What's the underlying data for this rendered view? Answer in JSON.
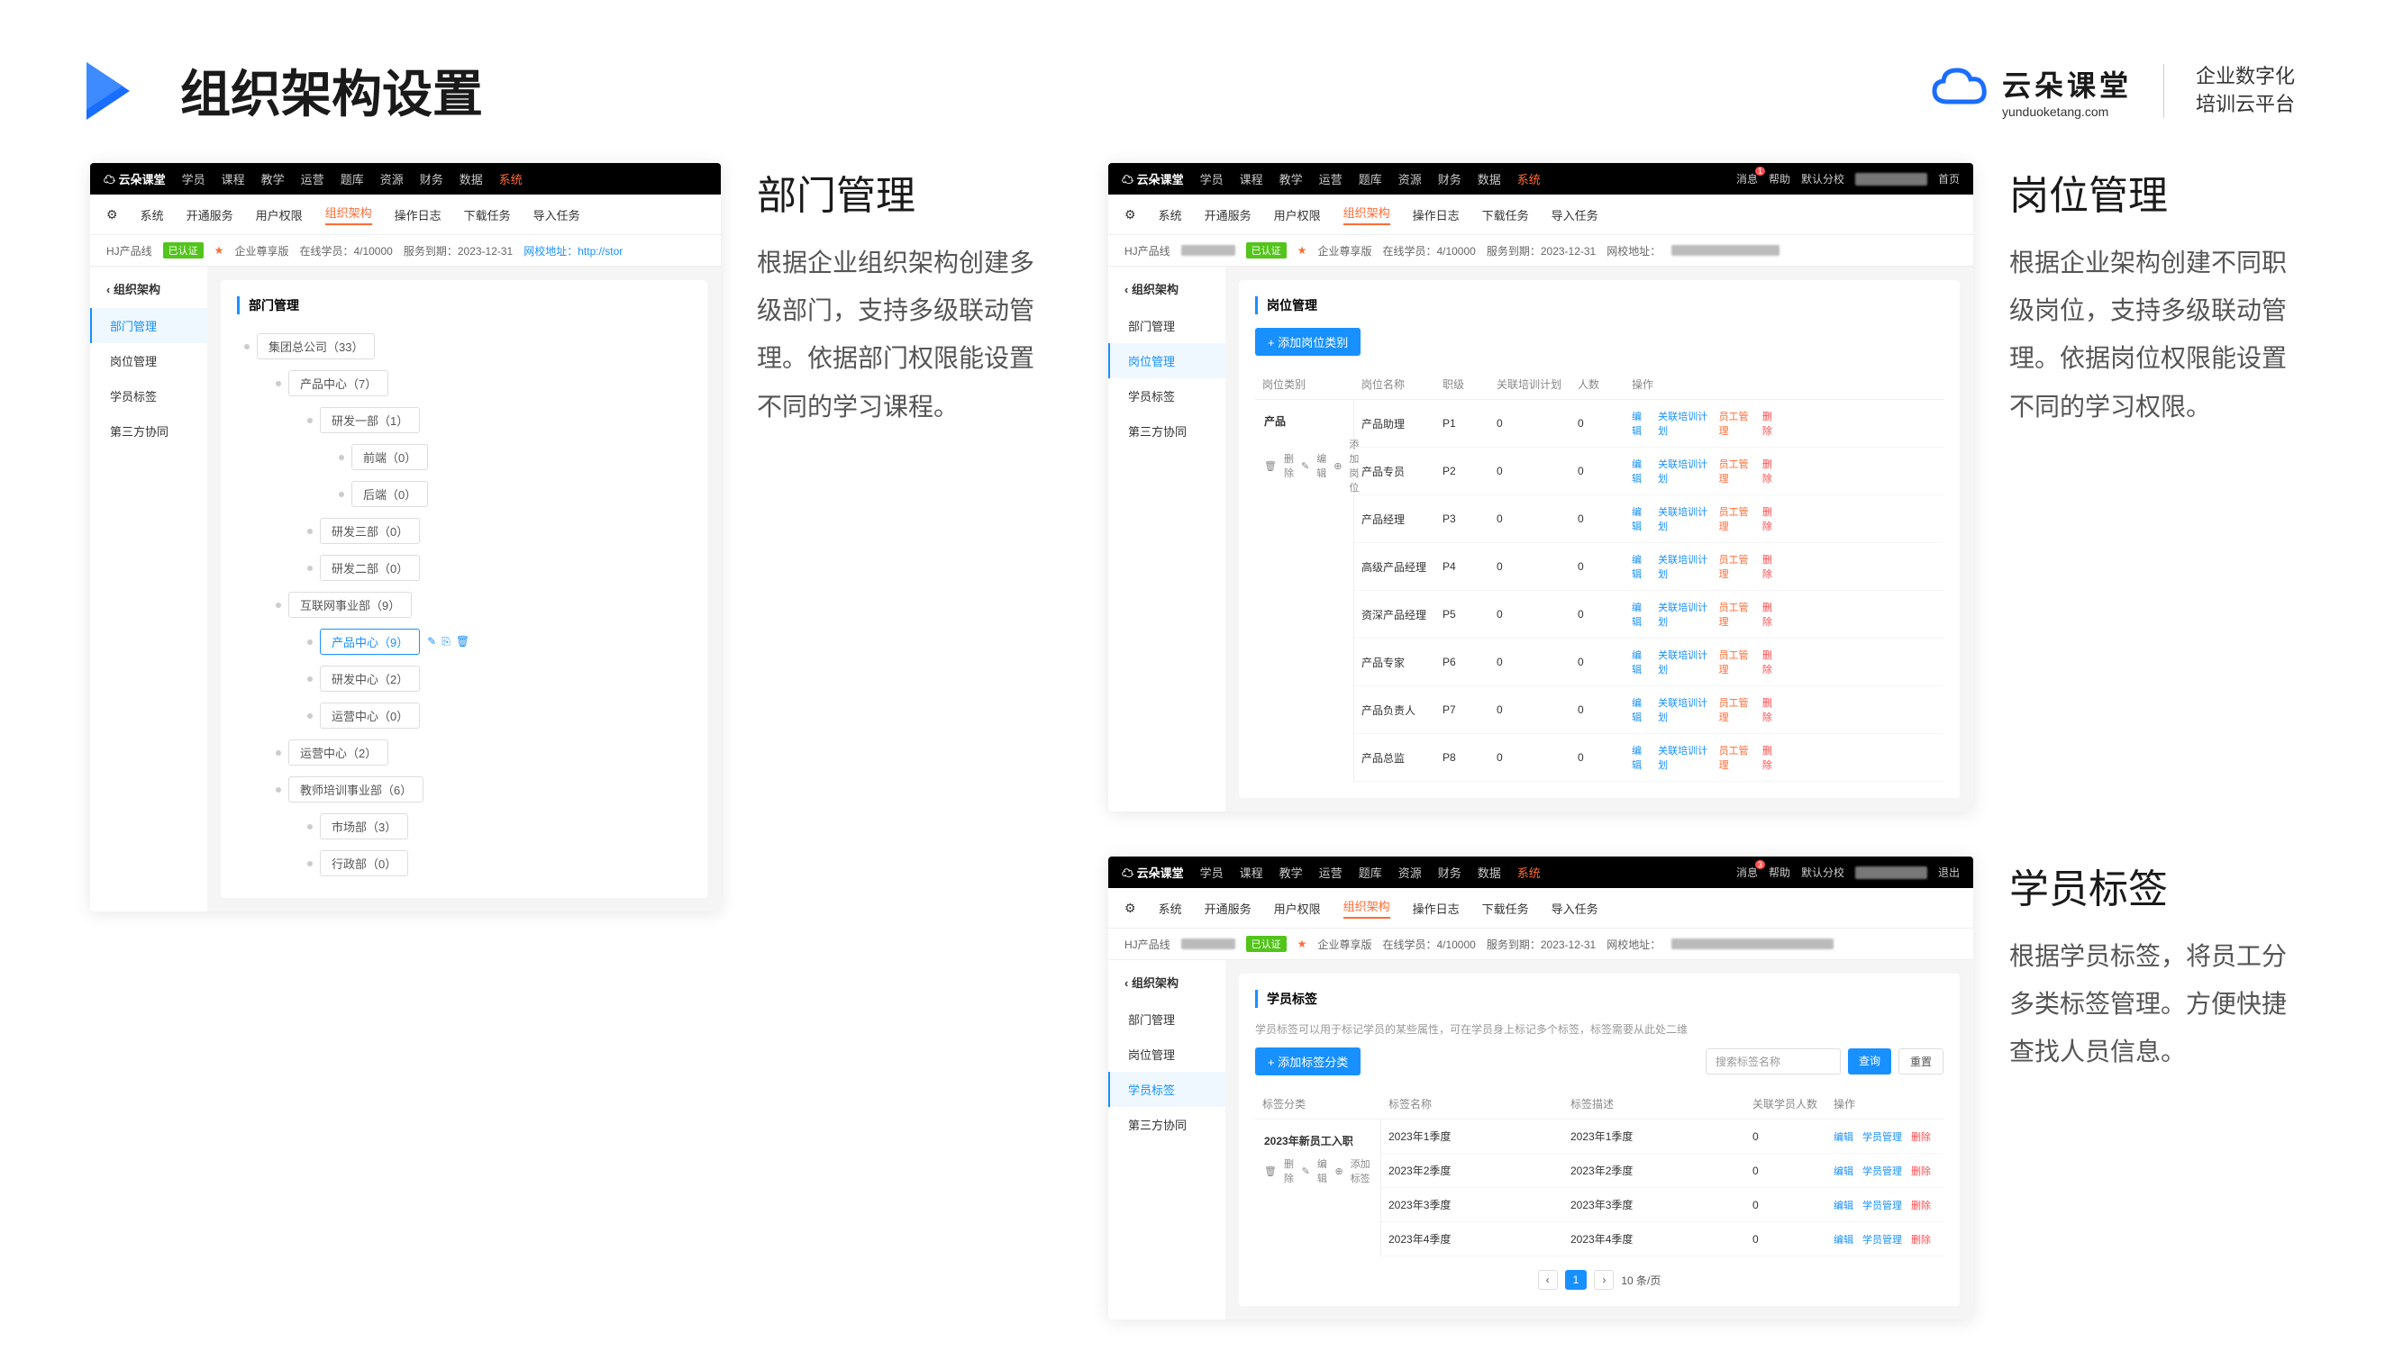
{
  "header": {
    "title": "组织架构设置",
    "brand": "云朵课堂",
    "brand_en": "yunduoketang.com",
    "slogan1": "企业数字化",
    "slogan2": "培训云平台"
  },
  "sections": {
    "dept": {
      "title": "部门管理",
      "desc": "根据企业组织架构创建多级部门，支持多级联动管理。依据部门权限能设置不同的学习课程。"
    },
    "job": {
      "title": "岗位管理",
      "desc": "根据企业架构创建不同职级岗位，支持多级联动管理。依据岗位权限能设置不同的学习权限。"
    },
    "tag": {
      "title": "学员标签",
      "desc": "根据学员标签，将员工分多类标签管理。方便快捷查找人员信息。"
    }
  },
  "topnav": [
    "学员",
    "课程",
    "教学",
    "运营",
    "题库",
    "资源",
    "财务",
    "数据",
    "系统"
  ],
  "subnav": [
    "开通服务",
    "用户权限",
    "组织架构",
    "操作日志",
    "下载任务",
    "导入任务"
  ],
  "sys": "系统",
  "hj": "HJ产品线",
  "meta": {
    "cert": "已认证",
    "plan": "企业尊享版",
    "online": "在线学员：4/10000",
    "expire": "服务到期：2023-12-31",
    "host": "网校地址：http://stor"
  },
  "top_right": {
    "msg": "消息",
    "help": "帮助",
    "branch": "默认分校",
    "home": "首页",
    "exit": "退出"
  },
  "sidebar": {
    "title": "组织架构",
    "items": [
      "部门管理",
      "岗位管理",
      "学员标签",
      "第三方协同"
    ]
  },
  "tree_title": "部门管理",
  "tree": [
    {
      "label": "集团总公司（33）",
      "level": 0
    },
    {
      "label": "产品中心（7）",
      "level": 1
    },
    {
      "label": "研发一部（1）",
      "level": 2
    },
    {
      "label": "前端（0）",
      "level": 3
    },
    {
      "label": "后端（0）",
      "level": 3
    },
    {
      "label": "研发三部（0）",
      "level": 2
    },
    {
      "label": "研发二部（0）",
      "level": 2
    },
    {
      "label": "互联网事业部（9）",
      "level": 1
    },
    {
      "label": "产品中心（9）",
      "level": 2,
      "selected": true
    },
    {
      "label": "研发中心（2）",
      "level": 2
    },
    {
      "label": "运营中心（0）",
      "level": 2
    },
    {
      "label": "运营中心（2）",
      "level": 1
    },
    {
      "label": "教师培训事业部（6）",
      "level": 1
    },
    {
      "label": "市场部（3）",
      "level": 2
    },
    {
      "label": "行政部（0）",
      "level": 2
    }
  ],
  "job": {
    "panel_title": "岗位管理",
    "add_btn": "+  添加岗位类别",
    "headers": [
      "岗位类别",
      "岗位名称",
      "职级",
      "关联培训计划",
      "人数",
      "操作"
    ],
    "cat": "产品",
    "cat_ops": {
      "del": "删除",
      "edit": "编辑",
      "add": "添加岗位"
    },
    "rows": [
      {
        "name": "产品助理",
        "level": "P1",
        "plan": 0,
        "count": 0
      },
      {
        "name": "产品专员",
        "level": "P2",
        "plan": 0,
        "count": 0
      },
      {
        "name": "产品经理",
        "level": "P3",
        "plan": 0,
        "count": 0
      },
      {
        "name": "高级产品经理",
        "level": "P4",
        "plan": 0,
        "count": 0
      },
      {
        "name": "资深产品经理",
        "level": "P5",
        "plan": 0,
        "count": 0
      },
      {
        "name": "产品专家",
        "level": "P6",
        "plan": 0,
        "count": 0
      },
      {
        "name": "产品负责人",
        "level": "P7",
        "plan": 0,
        "count": 0
      },
      {
        "name": "产品总监",
        "level": "P8",
        "plan": 0,
        "count": 0
      }
    ],
    "ops": {
      "edit": "编辑",
      "plan": "关联培训计划",
      "emp": "员工管理",
      "del": "删除"
    }
  },
  "tag": {
    "panel_title": "学员标签",
    "tip": "学员标签可以用于标记学员的某些属性，可在学员身上标记多个标签，标签需要从此处二维",
    "add_btn": "+  添加标签分类",
    "search_ph": "搜索标签名称",
    "search_btn": "查询",
    "reset_btn": "重置",
    "headers": [
      "标签分类",
      "标签名称",
      "标签描述",
      "关联学员人数",
      "操作"
    ],
    "cat": "2023年新员工入职",
    "cat_ops": {
      "del": "删除",
      "edit": "编辑",
      "add": "添加标签"
    },
    "rows": [
      {
        "name": "2023年1季度",
        "desc": "2023年1季度",
        "count": 0
      },
      {
        "name": "2023年2季度",
        "desc": "2023年2季度",
        "count": 0
      },
      {
        "name": "2023年3季度",
        "desc": "2023年3季度",
        "count": 0
      },
      {
        "name": "2023年4季度",
        "desc": "2023年4季度",
        "count": 0
      }
    ],
    "ops": {
      "edit": "编辑",
      "emp": "学员管理",
      "del": "删除"
    },
    "pager": {
      "page": "1",
      "size": "10 条/页"
    }
  }
}
